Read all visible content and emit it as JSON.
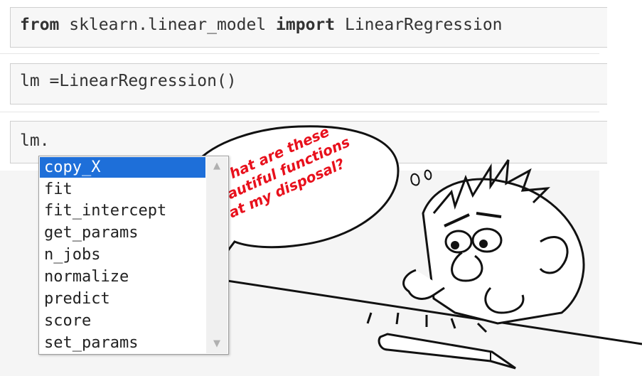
{
  "cells": [
    {
      "keyword1": "from",
      "mid": " sklearn.linear_model ",
      "keyword2": "import",
      "rest": " LinearRegression"
    },
    {
      "code": "lm =LinearRegression()"
    },
    {
      "code": "lm."
    }
  ],
  "autocomplete": {
    "items": [
      "copy_X",
      "fit",
      "fit_intercept",
      "get_params",
      "n_jobs",
      "normalize",
      "predict",
      "score",
      "set_params"
    ],
    "selected": "copy_X"
  },
  "speech_bubble": {
    "lines": [
      "What are these",
      "beautiful functions",
      "at my disposal?"
    ]
  },
  "colors": {
    "selection": "#1e6fd9",
    "bubble_text": "#e8101c",
    "keyword": "#008000"
  }
}
